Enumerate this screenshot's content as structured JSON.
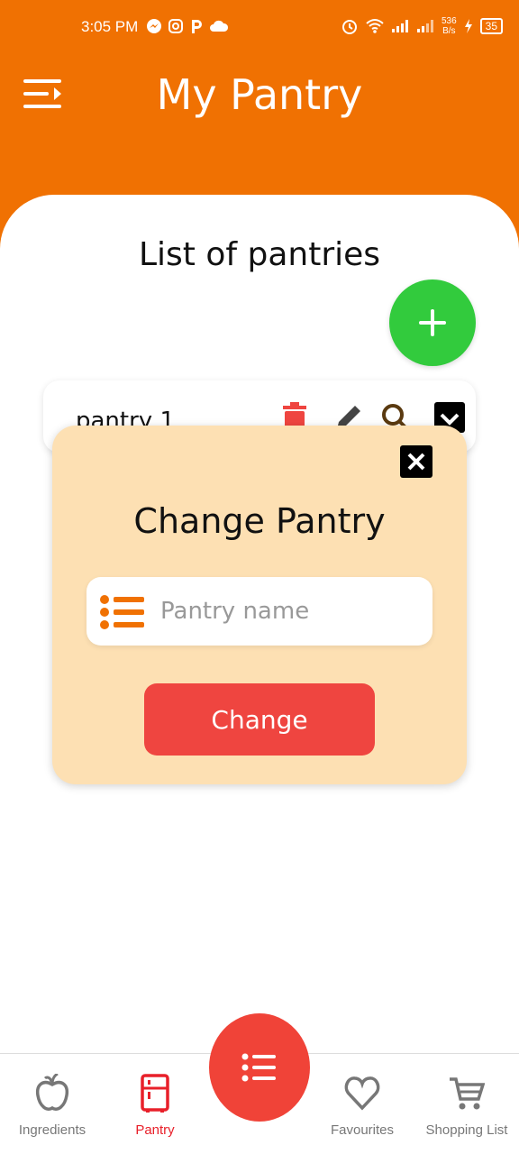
{
  "status_bar": {
    "time": "3:05 PM",
    "speed_value": "536",
    "speed_unit": "B/s",
    "battery": "35"
  },
  "header": {
    "title": "My Pantry"
  },
  "main": {
    "section_title": "List of pantries",
    "pantries": [
      {
        "name": "pantry 1"
      }
    ]
  },
  "dialog": {
    "title": "Change Pantry",
    "input_placeholder": "Pantry name",
    "input_value": "",
    "submit_label": "Change"
  },
  "bottom_nav": {
    "items": [
      {
        "label": "Ingredients",
        "icon": "apple-icon"
      },
      {
        "label": "Pantry",
        "icon": "fridge-icon",
        "active": true
      },
      {
        "label": "Favourites",
        "icon": "heart-icon"
      },
      {
        "label": "Shopping List",
        "icon": "cart-icon"
      }
    ],
    "center_icon": "list-icon"
  },
  "colors": {
    "brand": "#f07102",
    "add": "#32cb3d",
    "accent_red": "#ef4540",
    "dialog_bg": "#fde0b3"
  }
}
